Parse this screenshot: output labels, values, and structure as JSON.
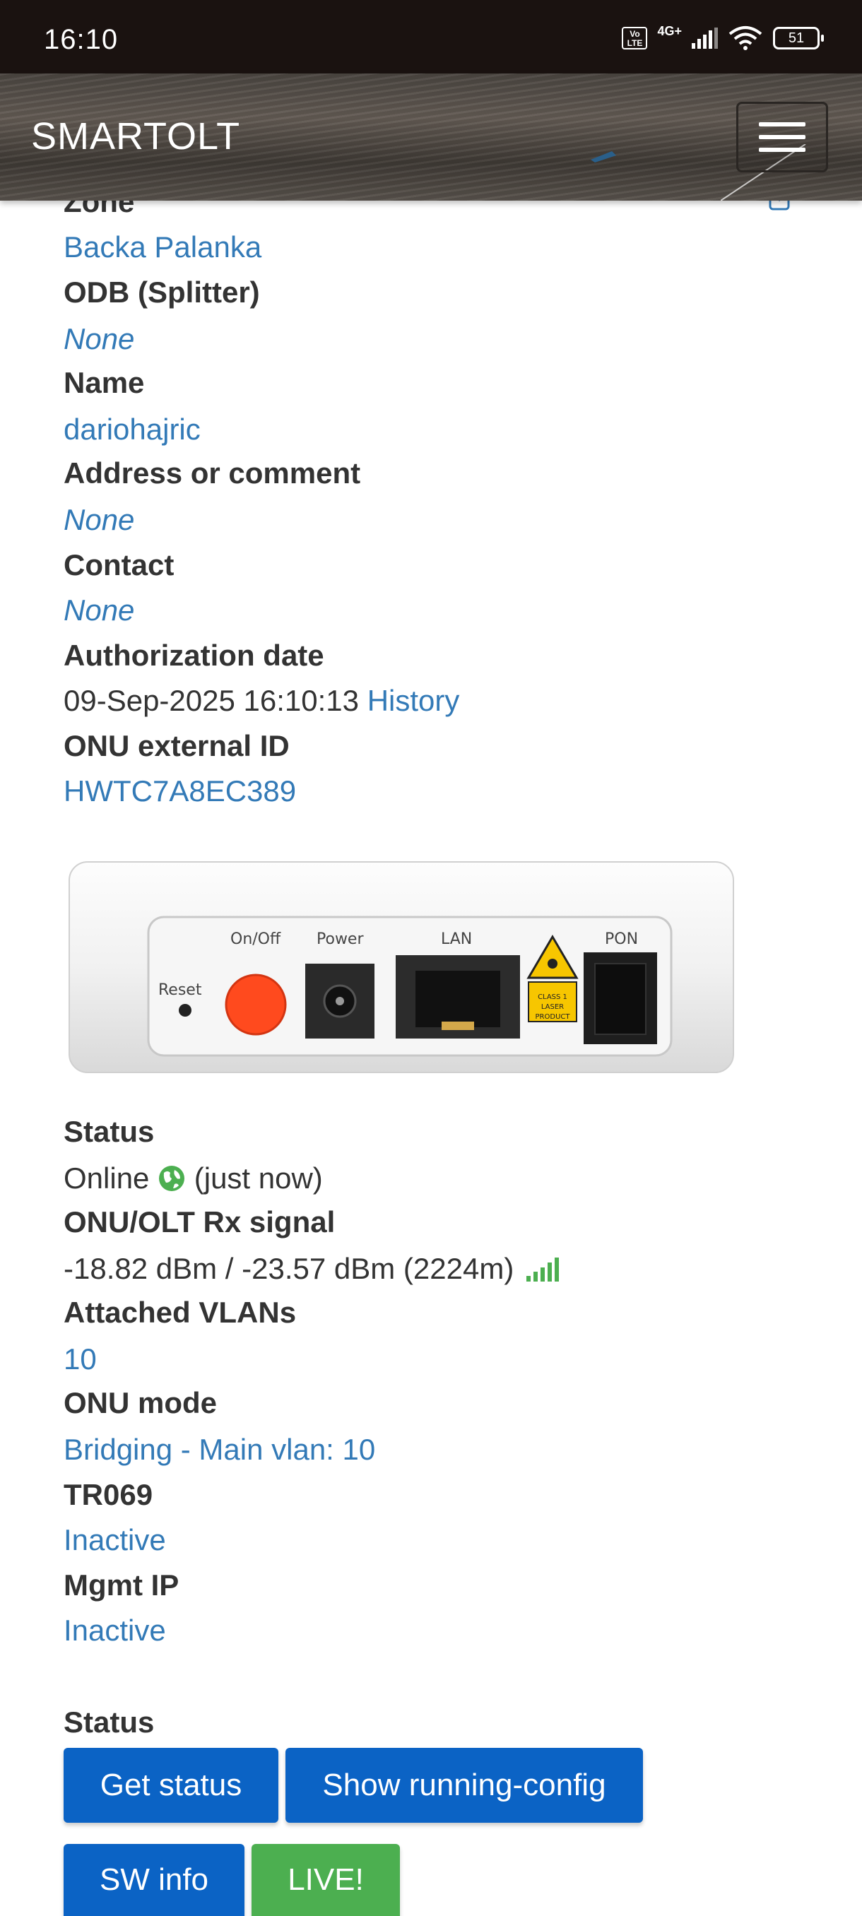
{
  "status_bar": {
    "time": "16:10",
    "volte": "Vo LTE",
    "network": "4G+",
    "battery": "51"
  },
  "navbar": {
    "brand": "SMARTOLT",
    "menu_icon": "hamburger-menu-icon"
  },
  "details": {
    "zone_label": "Zone",
    "zone_value": "Backa Palanka",
    "odb_label": "ODB (Splitter)",
    "odb_value": "None",
    "name_label": "Name",
    "name_value": "dariohajric",
    "address_label": "Address or comment",
    "address_value": "None",
    "contact_label": "Contact",
    "contact_value": "None",
    "auth_label": "Authorization date",
    "auth_value": "09-Sep-2025 16:10:13",
    "history_link": "History",
    "external_id_label": "ONU external ID",
    "external_id_value": "HWTC7A8EC389"
  },
  "device_image": {
    "reset": "Reset",
    "onoff": "On/Off",
    "power": "Power",
    "lan": "LAN",
    "pon": "PON",
    "laser_label": "CLASS 1 LASER PRODUCT"
  },
  "status_info": {
    "status_label": "Status",
    "status_value": "Online",
    "status_time": "(just now)",
    "signal_label": "ONU/OLT Rx signal",
    "signal_value": "-18.82 dBm / -23.57 dBm (2224m)",
    "vlans_label": "Attached VLANs",
    "vlans_value": "10",
    "mode_label": "ONU mode",
    "mode_value": "Bridging - Main vlan: 10",
    "tr069_label": "TR069",
    "tr069_value": "Inactive",
    "mgmt_label": "Mgmt IP",
    "mgmt_value": "Inactive"
  },
  "actions": {
    "section_label": "Status",
    "get_status": "Get status",
    "show_config": "Show running-config",
    "sw_info": "SW info",
    "live": "LIVE!"
  },
  "colors": {
    "link": "#337ab7",
    "primary_button": "#0b63c5",
    "success_button": "#4caf50"
  }
}
